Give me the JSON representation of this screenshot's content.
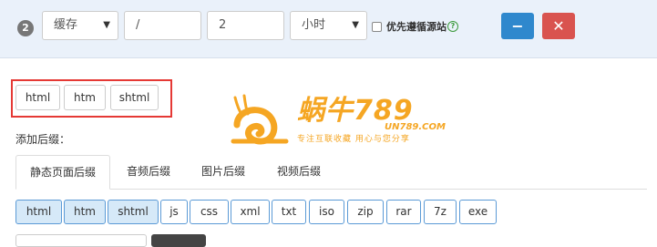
{
  "rule": {
    "number": "2",
    "action_select": "缓存",
    "path_value": "/",
    "time_value": "2",
    "unit_select": "小时",
    "priority_label": "优先遵循源站",
    "help_icon": "?",
    "minus_label": "−",
    "remove_label": "✕"
  },
  "selected_suffixes": [
    "html",
    "htm",
    "shtml"
  ],
  "watermark": {
    "title": "蜗牛789",
    "domain": "UN789.COM",
    "slogan": "专注互联收藏   用心与您分享"
  },
  "add_label": "添加后缀：",
  "tabs": [
    "静态页面后缀",
    "音频后缀",
    "图片后缀",
    "视频后缀"
  ],
  "active_tab": 0,
  "suffix_options": [
    {
      "label": "html",
      "selected": true
    },
    {
      "label": "htm",
      "selected": true
    },
    {
      "label": "shtml",
      "selected": true
    },
    {
      "label": "js",
      "selected": false
    },
    {
      "label": "css",
      "selected": false
    },
    {
      "label": "xml",
      "selected": false
    },
    {
      "label": "txt",
      "selected": false
    },
    {
      "label": "iso",
      "selected": false
    },
    {
      "label": "zip",
      "selected": false
    },
    {
      "label": "rar",
      "selected": false
    },
    {
      "label": "7z",
      "selected": false
    },
    {
      "label": "exe",
      "selected": false
    }
  ],
  "colors": {
    "accent_blue": "#2f88cd",
    "danger_red": "#d9534f",
    "highlight_red": "#e53935",
    "watermark_orange": "#f5a623"
  }
}
